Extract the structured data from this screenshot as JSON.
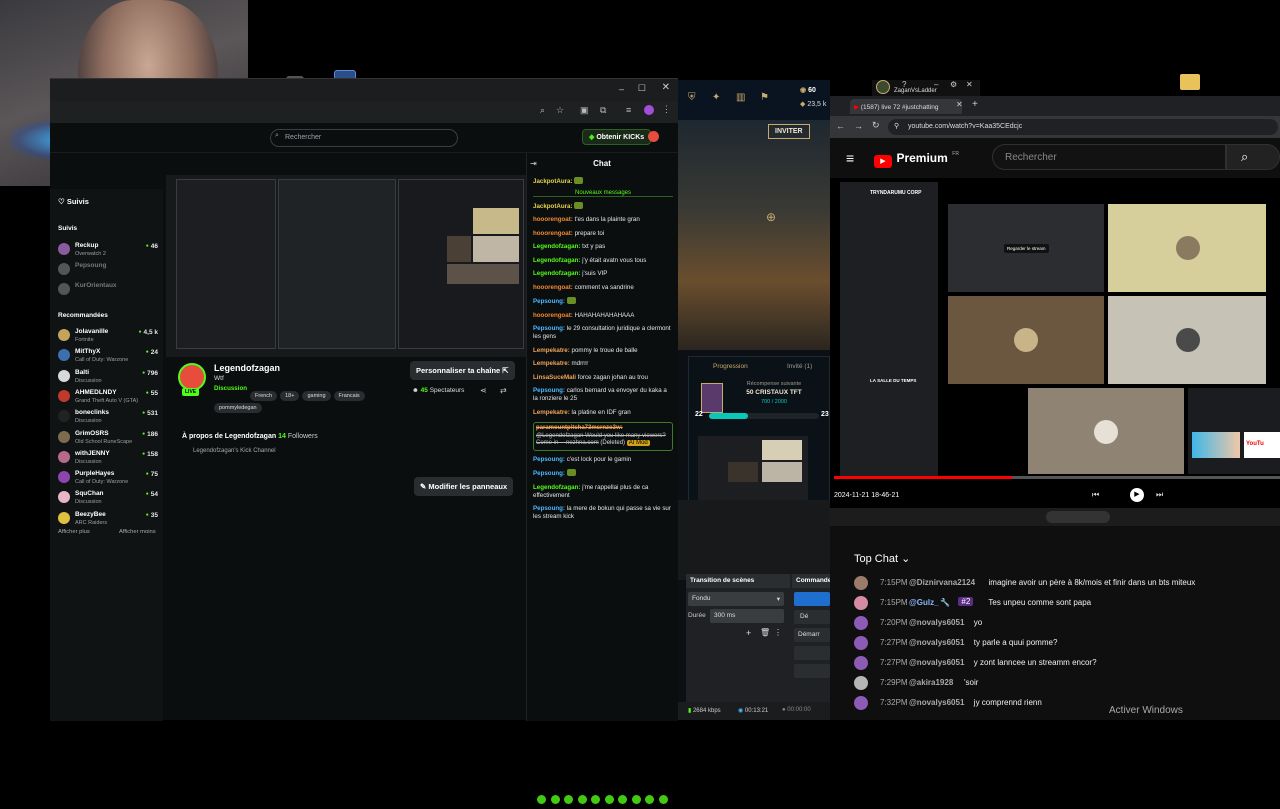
{
  "kick": {
    "search_placeholder": "Rechercher",
    "get_kicks": "Obtenir KICKs",
    "sidebar": {
      "following_title": "Suivis",
      "following": [
        {
          "name": "Reckup",
          "category": "Overwatch 2",
          "viewers": "46",
          "live": true,
          "color": "#8a5b9e"
        },
        {
          "name": "Pepsoung",
          "category": "",
          "viewers": "",
          "live": false,
          "color": "#555"
        },
        {
          "name": "KurOrientaux",
          "category": "",
          "viewers": "",
          "live": false,
          "color": "#555"
        }
      ],
      "recommended_title": "Recommandées",
      "recommended": [
        {
          "name": "Jolavanille",
          "category": "Fortnite",
          "viewers": "4,5 k",
          "color": "#c4a35a"
        },
        {
          "name": "MitThyX",
          "category": "Call of Duty: Warzone",
          "viewers": "24",
          "color": "#3a6fb0"
        },
        {
          "name": "Balti",
          "category": "Discussion",
          "viewers": "796",
          "color": "#d9d9d9"
        },
        {
          "name": "AHMEDLNDY",
          "category": "Grand Theft Auto V (GTA)",
          "viewers": "55",
          "color": "#c0392b"
        },
        {
          "name": "boneclinks",
          "category": "Discussion",
          "viewers": "531",
          "color": "#222"
        },
        {
          "name": "GrimOSRS",
          "category": "Old School RuneScape",
          "viewers": "186",
          "color": "#7d6b4f"
        },
        {
          "name": "withJENNY",
          "category": "Discussion",
          "viewers": "158",
          "color": "#b7698b"
        },
        {
          "name": "PurpleHayes",
          "category": "Call of Duty: Warzone",
          "viewers": "75",
          "color": "#8e44ad"
        },
        {
          "name": "SquChan",
          "category": "Discussion",
          "viewers": "54",
          "color": "#e8b4c8"
        },
        {
          "name": "BeezyBee",
          "category": "ARC Raiders",
          "viewers": "35",
          "color": "#e0c040"
        }
      ],
      "show_more": "Afficher plus",
      "show_less": "Afficher moins"
    },
    "channel": {
      "name": "Legendofzagan",
      "live_badge": "LIVE",
      "stream_title": "Wtf",
      "category": "Discussion",
      "tags": [
        "French",
        "18+",
        "gaming",
        "Francais",
        "pommyledegan"
      ],
      "customize": "Personnaliser ta chaîne",
      "viewers": "45",
      "viewers_label": "Spectateurs",
      "about_title": "À propos de Legendofzagan",
      "followers_count": "14",
      "followers_label": "Followers",
      "about_text": "Legendofzagan's Kick Channel",
      "edit_panels": "Modifier les panneaux"
    },
    "chat": {
      "title": "Chat",
      "new_messages": "Nouveaux messages",
      "messages": [
        {
          "user": "JackpotAura:",
          "text": "",
          "color": "#e5d34b"
        },
        {
          "user": "JackpotAura:",
          "text": "",
          "color": "#e5d34b"
        },
        {
          "user": "hooorengoat:",
          "text": "t'es dans la plainte gran",
          "color": "#f08a32"
        },
        {
          "user": "hooorengoat:",
          "text": "prepare toi",
          "color": "#f08a32"
        },
        {
          "user": "Legendofzagan:",
          "text": "txt y pas",
          "color": "#53fc18"
        },
        {
          "user": "Legendofzagan:",
          "text": "j'y était avatn vous tous",
          "color": "#53fc18"
        },
        {
          "user": "Legendofzagan:",
          "text": "j'suis VIP",
          "color": "#53fc18"
        },
        {
          "user": "hooorengoat:",
          "text": "comment va sandrine",
          "color": "#f08a32"
        },
        {
          "user": "Pepsoung:",
          "text": "",
          "color": "#4db8ff"
        },
        {
          "user": "hooorengoat:",
          "text": "HAHAHAHAHAHAAA",
          "color": "#f08a32"
        },
        {
          "user": "Pepsoung:",
          "text": "le 29 consultation juridique a clermont les gens",
          "color": "#4db8ff"
        },
        {
          "user": "Lempekatre:",
          "text": "pommy le troue de balle",
          "color": "#f0a35a"
        },
        {
          "user": "Lempekatre:",
          "text": "mdrrrr",
          "color": "#f0a35a"
        },
        {
          "user": "LinsaSuceMali",
          "text": "force zagan johan au trou",
          "color": "#f0a35a"
        },
        {
          "user": "Pepsoung:",
          "text": "carlos bernard va envoyer du kaka a la ronziere le 25",
          "color": "#4db8ff"
        },
        {
          "user": "Lempekatre:",
          "text": "la platine en IDF gran",
          "color": "#f0a35a"
        }
      ],
      "deleted_user": "paramountpitcha73mcrnzo3w:",
      "deleted_text": "@Legendofzagan Would you like many viewers? Come in ---nezhna.com",
      "deleted_tag": "(Deleted)",
      "deleted_mod": "AI Mod",
      "messages2": [
        {
          "user": "Pepsoung:",
          "text": "c'est lock pour le gamin",
          "color": "#4db8ff"
        },
        {
          "user": "Pepsoung:",
          "text": "",
          "color": "#4db8ff"
        },
        {
          "user": "Legendofzagan:",
          "text": "j'me rappellai plus de ca effectivement",
          "color": "#53fc18"
        },
        {
          "user": "Pepsoung:",
          "text": "la mere de bokun qui passe sa vie sur les stream kick",
          "color": "#4db8ff"
        }
      ]
    }
  },
  "game": {
    "level": "60",
    "currency": "23,5 k",
    "invite": "INVITER",
    "progression_tab": "Progression",
    "invited_tab": "Invité (1)",
    "reward_title": "Récompense suivante",
    "reward_name": "50 CRISTAUX TFT",
    "reward_progress": "700 / 2000",
    "reward_progress_fraction": 0.35,
    "level_left": "22",
    "level_right": "23",
    "obs_transition_title": "Transition de scènes",
    "obs_commands_title": "Commandes",
    "obs_transition": "Fondu",
    "obs_duration_label": "Durée",
    "obs_duration": "300 ms",
    "obs_btn_1": "Dé",
    "obs_btn_2": "Démarr",
    "bitrate": "2684 kbps",
    "time1": "00:13:21",
    "time2": "00:00:00",
    "top_right_label": "ZaganVsLadder"
  },
  "youtube": {
    "tab_title": "(1587) live 72 #justchatting",
    "url": "youtube.com/watch?v=Kaa35CEdcjc",
    "brand": "Premium",
    "brand_region": "FR",
    "search_placeholder": "Rechercher",
    "video_date": "2024-11-21 18-46-21",
    "discord_server": "TRYNDARUMU CORP",
    "discord_channel": "LA SALLE DU TEMPS",
    "discord_watch": "Regarder le stream",
    "top_chat": "Top Chat",
    "chat": [
      {
        "time": "7:15PM",
        "user": "@Diznirvana2124",
        "badge": "",
        "text": "imagine avoir un père à 8k/mois et finir dans un bts miteux",
        "color": "#9c7b6b"
      },
      {
        "time": "7:15PM",
        "user": "@Gulz_",
        "badge": "#2",
        "text": "Tes unpeu comme sont papa",
        "color": "#d48ba3"
      },
      {
        "time": "7:20PM",
        "user": "@novalys6051",
        "badge": "",
        "text": "yo",
        "color": "#8d5bb5"
      },
      {
        "time": "7:27PM",
        "user": "@novalys6051",
        "badge": "",
        "text": "ty parle a quui pomme?",
        "color": "#8d5bb5"
      },
      {
        "time": "7:27PM",
        "user": "@novalys6051",
        "badge": "",
        "text": "y zont lanncee un streamm encor?",
        "color": "#8d5bb5"
      },
      {
        "time": "7:29PM",
        "user": "@akira1928",
        "badge": "",
        "text": "'soir",
        "color": "#b5b5b5"
      },
      {
        "time": "7:32PM",
        "user": "@novalys6051",
        "badge": "",
        "text": "jy comprennd rienn",
        "color": "#8d5bb5"
      }
    ],
    "activate_windows": "Activer Windows"
  },
  "colors": {
    "kick_green": "#53fc18",
    "yt_red": "#ff0000",
    "obs_blue": "#1f6fd1"
  }
}
